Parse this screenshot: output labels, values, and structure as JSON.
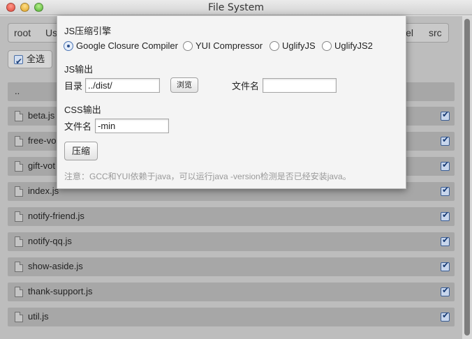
{
  "window": {
    "title": "File System"
  },
  "breadcrumb": {
    "items": [
      "root",
      "Us",
      "el",
      "src"
    ]
  },
  "toolbar": {
    "select_all_label": "全选"
  },
  "file_list": {
    "parent_label": "..",
    "files": [
      "beta.js",
      "free-vo",
      "gift-vot",
      "index.js",
      "notify-friend.js",
      "notify-qq.js",
      "show-aside.js",
      "thank-support.js",
      "util.js"
    ]
  },
  "dialog": {
    "engine_section_title": "JS压缩引擎",
    "engines": [
      "Google Closure Compiler",
      "YUI Compressor",
      "UglifyJS",
      "UglifyJS2"
    ],
    "selected_engine": "Google Closure Compiler",
    "js_output_title": "JS输出",
    "dir_label": "目录",
    "dir_value": "../dist/",
    "browse_label": "浏览",
    "js_filename_label": "文件名",
    "js_filename_value": "",
    "css_output_title": "CSS输出",
    "css_filename_label": "文件名",
    "css_filename_value": "-min",
    "compress_label": "压缩",
    "note": "注意：GCC和YUI依赖于java，可以运行java -version检测是否已经安装java。"
  },
  "colors": {
    "accent": "#4a74b3",
    "checkbox": "#173a73"
  }
}
